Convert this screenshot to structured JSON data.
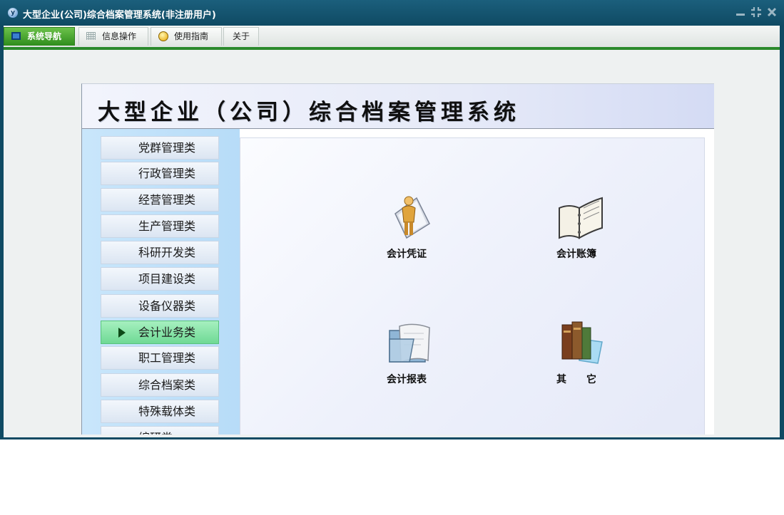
{
  "window": {
    "title": "大型企业(公司)综合档案管理系统(非注册用户)",
    "icon": "app-logo-icon",
    "controls": [
      "minimize-icon",
      "restore-icon",
      "close-icon"
    ]
  },
  "menubar": {
    "tabs": [
      {
        "label": "系统导航",
        "icon": "monitor-icon",
        "active": true
      },
      {
        "label": "信息操作",
        "icon": "grid-icon",
        "active": false
      },
      {
        "label": "使用指南",
        "icon": "lightbulb-icon",
        "active": false
      },
      {
        "label": "关于",
        "icon": "",
        "active": false
      }
    ],
    "accent_color": "#2b8a2b"
  },
  "panel": {
    "title": "大型企业（公司）综合档案管理系统"
  },
  "sidebar": {
    "items": [
      {
        "label": "党群管理类"
      },
      {
        "label": "行政管理类"
      },
      {
        "label": "经营管理类"
      },
      {
        "label": "生产管理类"
      },
      {
        "label": "科研开发类"
      },
      {
        "label": "项目建设类"
      },
      {
        "label": "设备仪器类"
      },
      {
        "label": "会计业务类",
        "active": true
      },
      {
        "label": "职工管理类"
      },
      {
        "label": "综合档案类"
      },
      {
        "label": "特殊载体类"
      },
      {
        "label": "编研类"
      }
    ],
    "active_color": "#6fd995"
  },
  "functions": [
    {
      "label": "会计凭证",
      "icon": "person-document-icon"
    },
    {
      "label": "会计账簿",
      "icon": "open-book-icon"
    },
    {
      "label": "会计报表",
      "icon": "folder-scroll-icon"
    },
    {
      "label": "其　　它",
      "icon": "books-icon"
    }
  ]
}
